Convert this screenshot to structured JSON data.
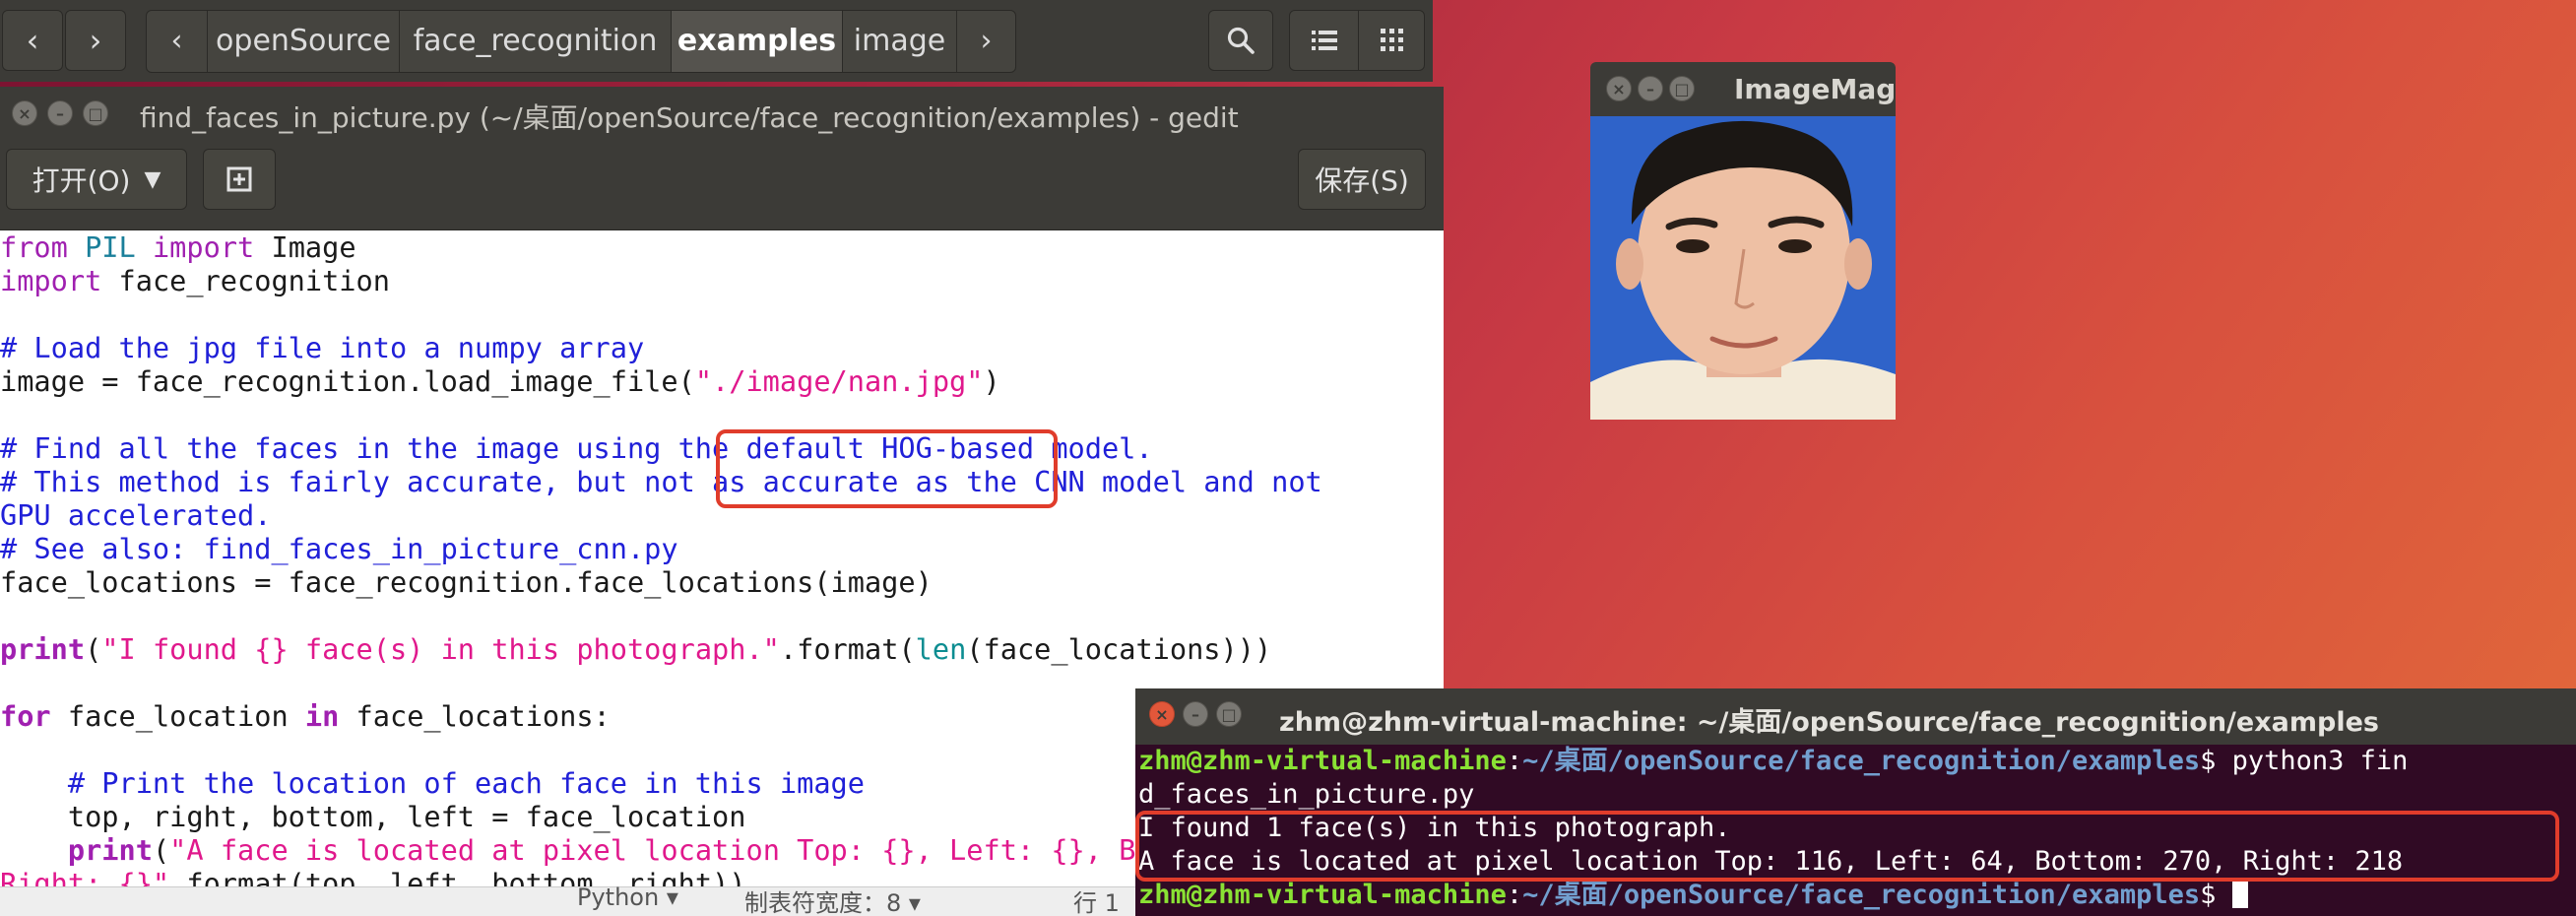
{
  "nautilus": {
    "back_glyph": "‹",
    "forward_glyph": "›",
    "crumb_prev_glyph": "‹",
    "crumb_next_glyph": "›",
    "breadcrumbs": [
      "openSource",
      "face_recognition",
      "examples",
      "image"
    ],
    "active_crumb": "examples"
  },
  "gedit": {
    "title": "find_faces_in_picture.py (~/桌面/openSource/face_recognition/examples) - gedit",
    "open_label": "打开(O)",
    "save_label": "保存(S)",
    "status": {
      "language": "Python ▾",
      "tab_width": "制表符宽度：8 ▾",
      "position": "行 1"
    }
  },
  "code": {
    "l1": {
      "kw1": "from",
      "mod": "PIL",
      "kw2": "import",
      "rest": "Image"
    },
    "l2": {
      "kw": "import",
      "rest": "face_recognition"
    },
    "l4": "# Load the jpg file into a numpy array",
    "l5": {
      "pre": "image = face_recognition.load_image_file(",
      "str": "\"./image/nan.jpg\"",
      "post": ")"
    },
    "l7": "# Find all the faces in the image using the default HOG-based model.",
    "l8": "# This method is fairly accurate, but not as accurate as the CNN model and not",
    "l9": "GPU accelerated.",
    "l10": "# See also: find_faces_in_picture_cnn.py",
    "l11": "face_locations = face_recognition.face_locations(image)",
    "l13": {
      "fn": "print",
      "p1": "(",
      "str": "\"I found {} face(s) in this photograph.\"",
      "p2": ".format(",
      "bi": "len",
      "p3": "(face_locations)))"
    },
    "l15": {
      "kw1": "for",
      "mid": " face_location ",
      "kw2": "in",
      "rest": " face_locations:"
    },
    "l17": "    # Print the location of each face in this image",
    "l18": "    top, right, bottom, left = face_location",
    "l19": {
      "indent": "    ",
      "fn": "print",
      "p1": "(",
      "str": "\"A face is located at pixel location Top: {}, Left: {}, Bottom: {},"
    },
    "l20": {
      "str": "Right: {}\"",
      "rest": ".format(top, left, bottom, right))"
    }
  },
  "imagemagick": {
    "title": "ImageMagick"
  },
  "terminal": {
    "title": "zhm@zhm-virtual-machine: ~/桌面/openSource/face_recognition/examples",
    "user_host": "zhm@zhm-virtual-machine",
    "path": "~/桌面/openSource/face_recognition/examples",
    "prompt_sym": "$",
    "cmd_part1": " python3 fin",
    "cmd_part2": "d_faces_in_picture.py",
    "out1": "I found 1 face(s) in this photograph.",
    "out2": "A face is located at pixel location Top: 116, Left: 64, Bottom: 270, Right: 218"
  },
  "colors": {
    "highlight_box": "#e03c2b",
    "terminal_bg": "#300a24",
    "photo_bg": "#2f63c9"
  }
}
